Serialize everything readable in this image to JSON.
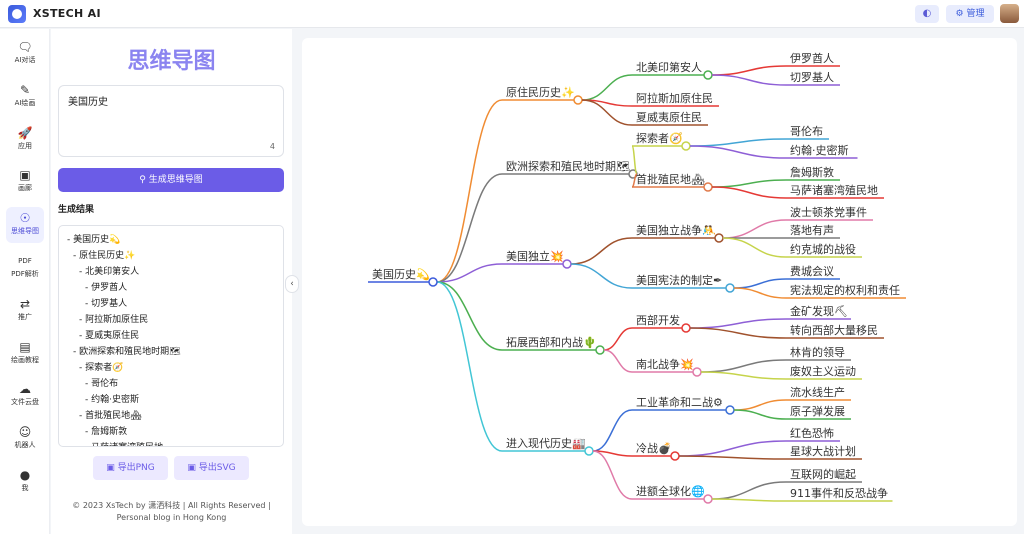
{
  "app": {
    "title": "XSTECH AI"
  },
  "header": {
    "wechat_icon": "wechat-icon",
    "admin_label": "⚙ 管理"
  },
  "rail": [
    {
      "label": "AI对话",
      "icon": "🗨"
    },
    {
      "label": "AI绘画",
      "icon": "✎"
    },
    {
      "label": "应用",
      "icon": "🚀"
    },
    {
      "label": "画廊",
      "icon": "▣"
    },
    {
      "label": "思维导图",
      "icon": "☉"
    },
    {
      "label": "PDF解析",
      "icon": "PDF"
    },
    {
      "label": "推广",
      "icon": "⇄"
    },
    {
      "label": "绘画教程",
      "icon": "▤"
    },
    {
      "label": "文件云盘",
      "icon": "☁"
    },
    {
      "label": "机器人",
      "icon": "☺"
    },
    {
      "label": "我",
      "icon": "●"
    }
  ],
  "panel": {
    "title": "思维导图",
    "topic_value": "美国历史",
    "char_count": "4",
    "generate_label": "生成思维导图",
    "results_label": "生成结果",
    "export_png": "导出PNG",
    "export_svg": "导出SVG",
    "footer": "© 2023 XsTech by 潇洒科技 | All Rights Reserved | Personal blog in Hong Kong"
  },
  "results": [
    "- 美国历史💫",
    "- 原住民历史✨",
    "- 北美印第安人",
    "- 伊罗酋人",
    "- 切罗基人",
    "- 阿拉斯加原住民",
    "- 夏威夷原住民",
    "- 欧洲探索和殖民地时期🗺",
    "- 探索者🧭",
    "- 哥伦布",
    "- 约翰·史密斯",
    "- 首批殖民地🏘",
    "- 詹姆斯敦",
    "- 马萨诸塞湾殖民地"
  ],
  "mindmap": {
    "root": "美国历史💫",
    "branches": [
      {
        "label": "原住民历史✨",
        "color": "#f08c33",
        "children": [
          {
            "label": "北美印第安人",
            "color": "#4caf50",
            "children": [
              {
                "label": "伊罗酋人",
                "color": "#e53935"
              },
              {
                "label": "切罗基人",
                "color": "#8e5fd6"
              }
            ]
          },
          {
            "label": "阿拉斯加原住民",
            "color": "#e53935",
            "children": []
          },
          {
            "label": "夏威夷原住民",
            "color": "#a0522d",
            "children": []
          }
        ]
      },
      {
        "label": "欧洲探索和殖民地时期🗺",
        "color": "#7a7a7a",
        "children": [
          {
            "label": "探索者🧭",
            "color": "#c6d44b",
            "children": [
              {
                "label": "哥伦布",
                "color": "#42a5d5"
              },
              {
                "label": "约翰·史密斯",
                "color": "#8e5fd6"
              }
            ]
          },
          {
            "label": "首批殖民地🏘",
            "color": "#e07a4a",
            "children": [
              {
                "label": "詹姆斯敦",
                "color": "#4caf50"
              },
              {
                "label": "马萨诸塞湾殖民地",
                "color": "#e53935"
              }
            ]
          }
        ]
      },
      {
        "label": "美国独立💥",
        "color": "#8e5fd6",
        "children": [
          {
            "label": "美国独立战争🤼",
            "color": "#a0522d",
            "children": [
              {
                "label": "波士顿茶党事件",
                "color": "#e07aa8"
              },
              {
                "label": "落地有声",
                "color": "#7a7a7a"
              },
              {
                "label": "约克城的战役",
                "color": "#c6d44b"
              }
            ]
          },
          {
            "label": "美国宪法的制定✒",
            "color": "#42a5d5",
            "children": [
              {
                "label": "费城会议",
                "color": "#3b6fd6"
              },
              {
                "label": "宪法规定的权利和责任",
                "color": "#f08c33"
              }
            ]
          }
        ]
      },
      {
        "label": "拓展西部和内战🌵",
        "color": "#4caf50",
        "children": [
          {
            "label": "西部开发",
            "color": "#e53935",
            "children": [
              {
                "label": "金矿发现⛏",
                "color": "#8e5fd6"
              },
              {
                "label": "转向西部大量移民",
                "color": "#a0522d"
              }
            ]
          },
          {
            "label": "南北战争💥",
            "color": "#e07aa8",
            "children": [
              {
                "label": "林肯的领导",
                "color": "#7a7a7a"
              },
              {
                "label": "废奴主义运动",
                "color": "#c6d44b"
              }
            ]
          }
        ]
      },
      {
        "label": "进入现代历史🏭",
        "color": "#42c6d5",
        "children": [
          {
            "label": "工业革命和二战⚙",
            "color": "#3b6fd6",
            "children": [
              {
                "label": "流水线生产",
                "color": "#f08c33"
              },
              {
                "label": "原子弹发展",
                "color": "#4caf50"
              }
            ]
          },
          {
            "label": "冷战💣",
            "color": "#e53935",
            "children": [
              {
                "label": "红色恐怖",
                "color": "#8e5fd6"
              },
              {
                "label": "星球大战计划",
                "color": "#a0522d"
              }
            ]
          },
          {
            "label": "进额全球化🌐",
            "color": "#e07aa8",
            "children": [
              {
                "label": "互联网的崛起",
                "color": "#7a7a7a"
              },
              {
                "label": "911事件和反恐战争",
                "color": "#c6d44b"
              }
            ]
          }
        ]
      }
    ]
  }
}
